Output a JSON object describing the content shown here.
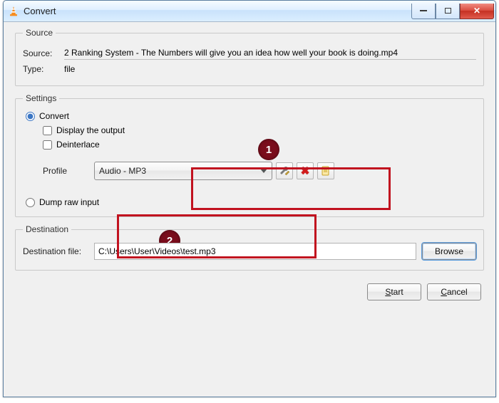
{
  "window": {
    "title": "Convert"
  },
  "source": {
    "legend": "Source",
    "source_label": "Source:",
    "source_value": "2 Ranking System - The Numbers will give you an idea how well your book is doing.mp4",
    "type_label": "Type:",
    "type_value": "file"
  },
  "settings": {
    "legend": "Settings",
    "convert_label": "Convert",
    "display_output_label": "Display the output",
    "deinterlace_label": "Deinterlace",
    "profile_label": "Profile",
    "profile_selected": "Audio - MP3",
    "dump_label": "Dump raw input",
    "tool_config_name": "wrench-icon",
    "tool_delete_name": "delete-icon",
    "tool_new_name": "new-profile-icon"
  },
  "destination": {
    "legend": "Destination",
    "file_label": "Destination file:",
    "file_value": "C:\\Users\\User\\Videos\\test.mp3",
    "browse_label": "Browse"
  },
  "buttons": {
    "start_pre": "",
    "start_ul": "S",
    "start_post": "tart",
    "cancel_pre": "",
    "cancel_ul": "C",
    "cancel_post": "ancel"
  },
  "annotations": {
    "one": "1",
    "two": "2"
  }
}
